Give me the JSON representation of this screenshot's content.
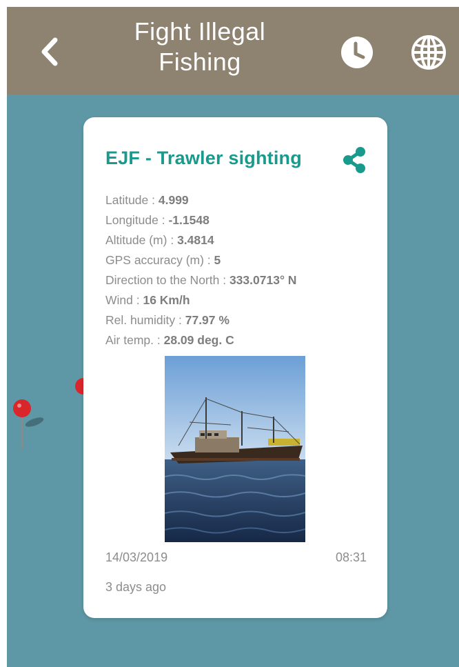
{
  "header": {
    "title_line1": "Fight Illegal",
    "title_line2": "Fishing"
  },
  "icons": {
    "back": "chevron-left-icon",
    "history": "clock-icon",
    "language": "globe-icon",
    "share": "share-icon",
    "map_pin": "map-pin-icon"
  },
  "colors": {
    "header_bg": "#8e8270",
    "map_bg": "#5e98a6",
    "accent": "#1a9a8c",
    "pin": "#d8262b"
  },
  "card": {
    "title": "EJF - Trawler sighting",
    "fields": [
      {
        "label": "Latitude : ",
        "value": "4.999"
      },
      {
        "label": "Longitude : ",
        "value": "-1.1548"
      },
      {
        "label": "Altitude (m) : ",
        "value": "3.4814"
      },
      {
        "label": "GPS accuracy (m) : ",
        "value": "5"
      },
      {
        "label": "Direction to the North : ",
        "value": "333.0713° N"
      },
      {
        "label": "Wind : ",
        "value": "16 Km/h"
      },
      {
        "label": "Rel. humidity : ",
        "value": "77.97 %"
      },
      {
        "label": "Air temp. : ",
        "value": "28.09 deg. C"
      }
    ],
    "date": "14/03/2019",
    "time": "08:31",
    "relative_time": "3 days ago"
  }
}
